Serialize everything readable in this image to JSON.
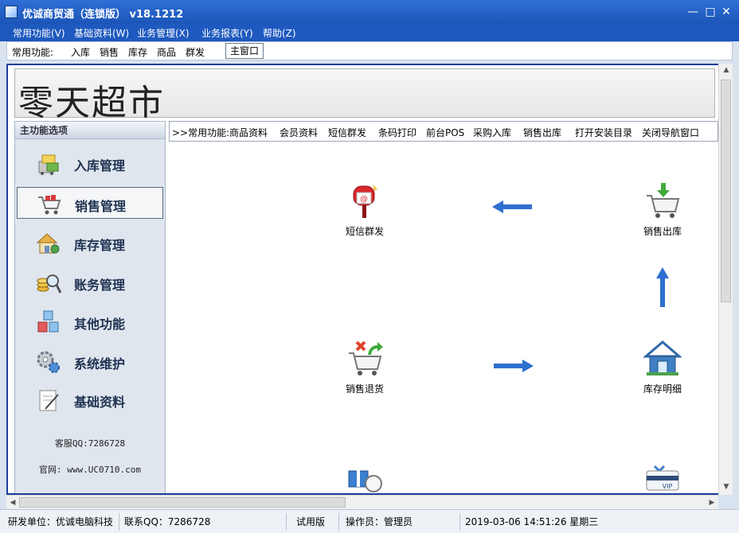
{
  "window": {
    "title": "优诚商贸通（连锁版） v18.1212",
    "minimize_glyph": "—",
    "maximize_glyph": "□",
    "close_glyph": "✕"
  },
  "menu": [
    {
      "label": "常用功能(V)"
    },
    {
      "label": "基础资料(W)"
    },
    {
      "label": "业务管理(X)"
    },
    {
      "label": "业务报表(Y)"
    },
    {
      "label": "帮助(Z)"
    }
  ],
  "toolbar": {
    "label": "常用功能:",
    "items": [
      "入库",
      "销售",
      "库存",
      "商品",
      "群发"
    ],
    "main_window_button": "主窗口"
  },
  "banner": {
    "store_name": "零天超市"
  },
  "left_panel": {
    "header": "主功能选项",
    "items": [
      {
        "label": "入库管理",
        "icon": "inbound-icon"
      },
      {
        "label": "销售管理",
        "icon": "shopping-cart-icon",
        "active": true
      },
      {
        "label": "库存管理",
        "icon": "warehouse-icon"
      },
      {
        "label": "账务管理",
        "icon": "coins-magnifier-icon"
      },
      {
        "label": "其他功能",
        "icon": "abc-blocks-icon"
      },
      {
        "label": "系统维护",
        "icon": "gears-icon"
      },
      {
        "label": "基础资料",
        "icon": "notepad-icon"
      }
    ],
    "support_qq": "客服QQ:7286728",
    "website": "官网: www.UC0710.com"
  },
  "quickbar": {
    "label": ">>常用功能:",
    "items": [
      "商品资料",
      "会员资料",
      "短信群发",
      "条码打印",
      "前台POS",
      "采购入库",
      "销售出库",
      "打开安装目录",
      "关闭导航窗口"
    ]
  },
  "flow": {
    "nodes": [
      {
        "label": "短信群发",
        "icon": "mailbox-icon"
      },
      {
        "label": "销售出库",
        "icon": "cart-download-icon"
      },
      {
        "label": "销售退货",
        "icon": "cart-return-icon"
      },
      {
        "label": "库存明细",
        "icon": "house-icon"
      },
      {
        "label": "",
        "icon": "gift-clock-icon"
      },
      {
        "label": "",
        "icon": "vip-card-icon"
      }
    ],
    "vip_text": "VIP"
  },
  "statusbar": {
    "developer": "研发单位：优诚电脑科技",
    "contact_qq": "联系QQ：7286728",
    "license": "试用版",
    "operator": "操作员：管理员",
    "datetime": "2019-03-06  14:51:26 星期三"
  },
  "colors": {
    "titlebar": "#2f6fd6",
    "menubar": "#1e59bf",
    "frame_border": "#1b3f9c",
    "arrow": "#2e6fd0"
  }
}
